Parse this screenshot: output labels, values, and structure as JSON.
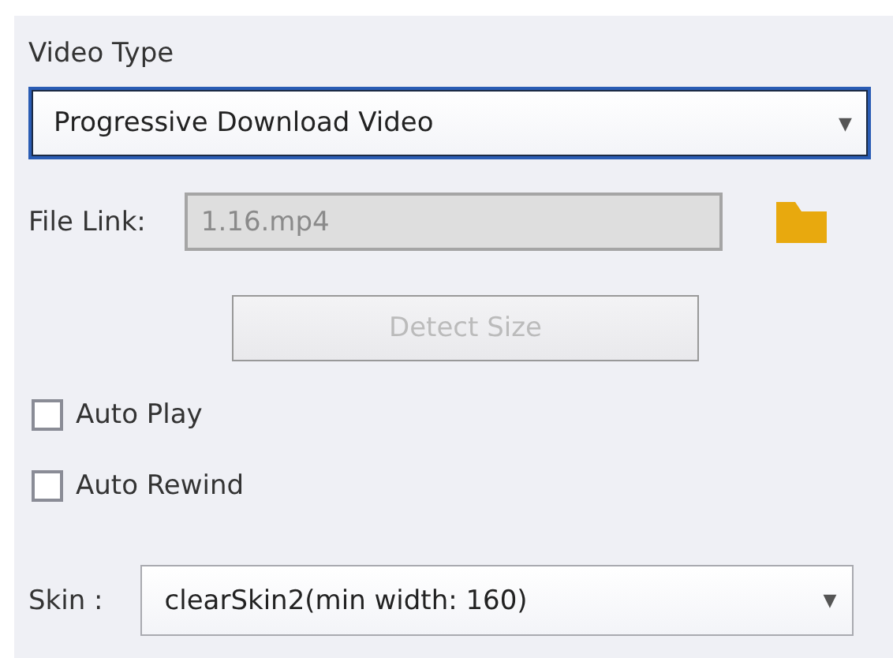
{
  "video_type": {
    "label": "Video Type",
    "value": "Progressive Download Video",
    "focused": true,
    "arrow": "▼"
  },
  "file_link": {
    "label": "File Link:",
    "value": "1.16.mp4",
    "disabled": true
  },
  "detect_button": {
    "label": "Detect Size",
    "disabled": true
  },
  "options": [
    {
      "label": "Auto Play",
      "checked": false
    },
    {
      "label": "Auto Rewind",
      "checked": false
    }
  ],
  "skin": {
    "label": "Skin :",
    "value": "clearSkin2(min width: 160)",
    "focused": false,
    "arrow": "▼"
  }
}
